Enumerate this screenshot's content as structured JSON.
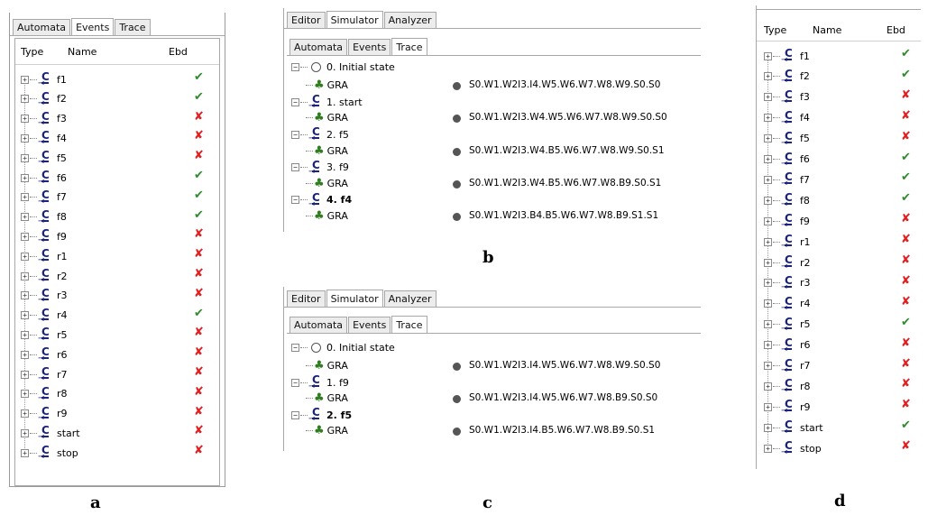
{
  "labels": {
    "a": "a",
    "b": "b",
    "c": "c",
    "d": "d"
  },
  "panel_a": {
    "tabs": [
      "Automata",
      "Events",
      "Trace"
    ],
    "active_tab": "Events",
    "columns": {
      "type": "Type",
      "name": "Name",
      "ebd": "Ebd"
    },
    "events": [
      {
        "name": "f1",
        "ebd": true
      },
      {
        "name": "f2",
        "ebd": true
      },
      {
        "name": "f3",
        "ebd": false
      },
      {
        "name": "f4",
        "ebd": false
      },
      {
        "name": "f5",
        "ebd": false
      },
      {
        "name": "f6",
        "ebd": true
      },
      {
        "name": "f7",
        "ebd": true
      },
      {
        "name": "f8",
        "ebd": true
      },
      {
        "name": "f9",
        "ebd": false
      },
      {
        "name": "r1",
        "ebd": false
      },
      {
        "name": "r2",
        "ebd": false
      },
      {
        "name": "r3",
        "ebd": false
      },
      {
        "name": "r4",
        "ebd": true
      },
      {
        "name": "r5",
        "ebd": false
      },
      {
        "name": "r6",
        "ebd": false
      },
      {
        "name": "r7",
        "ebd": false
      },
      {
        "name": "r8",
        "ebd": false
      },
      {
        "name": "r9",
        "ebd": false
      },
      {
        "name": "start",
        "ebd": false
      },
      {
        "name": "stop",
        "ebd": false
      }
    ]
  },
  "panel_b": {
    "top_tabs": [
      "Editor",
      "Simulator",
      "Analyzer"
    ],
    "sub_tabs": [
      "Automata",
      "Events",
      "Trace"
    ],
    "rows": [
      {
        "kind": "initial",
        "label": "0. Initial state"
      },
      {
        "kind": "gra",
        "label": "GRA",
        "state": "S0.W1.W2I3.I4.W5.W6.W7.W8.W9.S0.S0"
      },
      {
        "kind": "event",
        "label": "1. start",
        "bold": false
      },
      {
        "kind": "gra",
        "label": "GRA",
        "state": "S0.W1.W2I3.W4.W5.W6.W7.W8.W9.S0.S0"
      },
      {
        "kind": "event",
        "label": "2. f5",
        "bold": false
      },
      {
        "kind": "gra",
        "label": "GRA",
        "state": "S0.W1.W2I3.W4.B5.W6.W7.W8.W9.S0.S1"
      },
      {
        "kind": "event",
        "label": "3. f9",
        "bold": false
      },
      {
        "kind": "gra",
        "label": "GRA",
        "state": "S0.W1.W2I3.W4.B5.W6.W7.W8.B9.S0.S1"
      },
      {
        "kind": "event",
        "label": "4. f4",
        "bold": true
      },
      {
        "kind": "gra",
        "label": "GRA",
        "state": "S0.W1.W2I3.B4.B5.W6.W7.W8.B9.S1.S1"
      }
    ]
  },
  "panel_c": {
    "top_tabs": [
      "Editor",
      "Simulator",
      "Analyzer"
    ],
    "sub_tabs": [
      "Automata",
      "Events",
      "Trace"
    ],
    "rows": [
      {
        "kind": "initial",
        "label": "0. Initial state"
      },
      {
        "kind": "gra",
        "label": "GRA",
        "state": "S0.W1.W2I3.I4.W5.W6.W7.W8.W9.S0.S0"
      },
      {
        "kind": "event",
        "label": "1. f9",
        "bold": false
      },
      {
        "kind": "gra",
        "label": "GRA",
        "state": "S0.W1.W2I3.I4.W5.W6.W7.W8.B9.S0.S0"
      },
      {
        "kind": "event",
        "label": "2. f5",
        "bold": true
      },
      {
        "kind": "gra",
        "label": "GRA",
        "state": "S0.W1.W2I3.I4.B5.W6.W7.W8.B9.S0.S1"
      }
    ]
  },
  "panel_d": {
    "columns": {
      "type": "Type",
      "name": "Name",
      "ebd": "Ebd"
    },
    "events": [
      {
        "name": "f1",
        "ebd": true
      },
      {
        "name": "f2",
        "ebd": true
      },
      {
        "name": "f3",
        "ebd": false
      },
      {
        "name": "f4",
        "ebd": false
      },
      {
        "name": "f5",
        "ebd": false
      },
      {
        "name": "f6",
        "ebd": true
      },
      {
        "name": "f7",
        "ebd": true
      },
      {
        "name": "f8",
        "ebd": true
      },
      {
        "name": "f9",
        "ebd": false
      },
      {
        "name": "r1",
        "ebd": false
      },
      {
        "name": "r2",
        "ebd": false
      },
      {
        "name": "r3",
        "ebd": false
      },
      {
        "name": "r4",
        "ebd": false
      },
      {
        "name": "r5",
        "ebd": true
      },
      {
        "name": "r6",
        "ebd": false
      },
      {
        "name": "r7",
        "ebd": false
      },
      {
        "name": "r8",
        "ebd": false
      },
      {
        "name": "r9",
        "ebd": false
      },
      {
        "name": "start",
        "ebd": true
      },
      {
        "name": "stop",
        "ebd": false
      }
    ]
  },
  "glyphs": {
    "check": "✔",
    "cross": "✘",
    "plus": "+",
    "minus": "−",
    "c": "C",
    "arrow": "→",
    "tree": "♣"
  },
  "colors": {
    "check": "#2e8b2e",
    "cross": "#e02020",
    "event_icon": "#1a237e",
    "tree_icon": "#2f7d1e"
  }
}
